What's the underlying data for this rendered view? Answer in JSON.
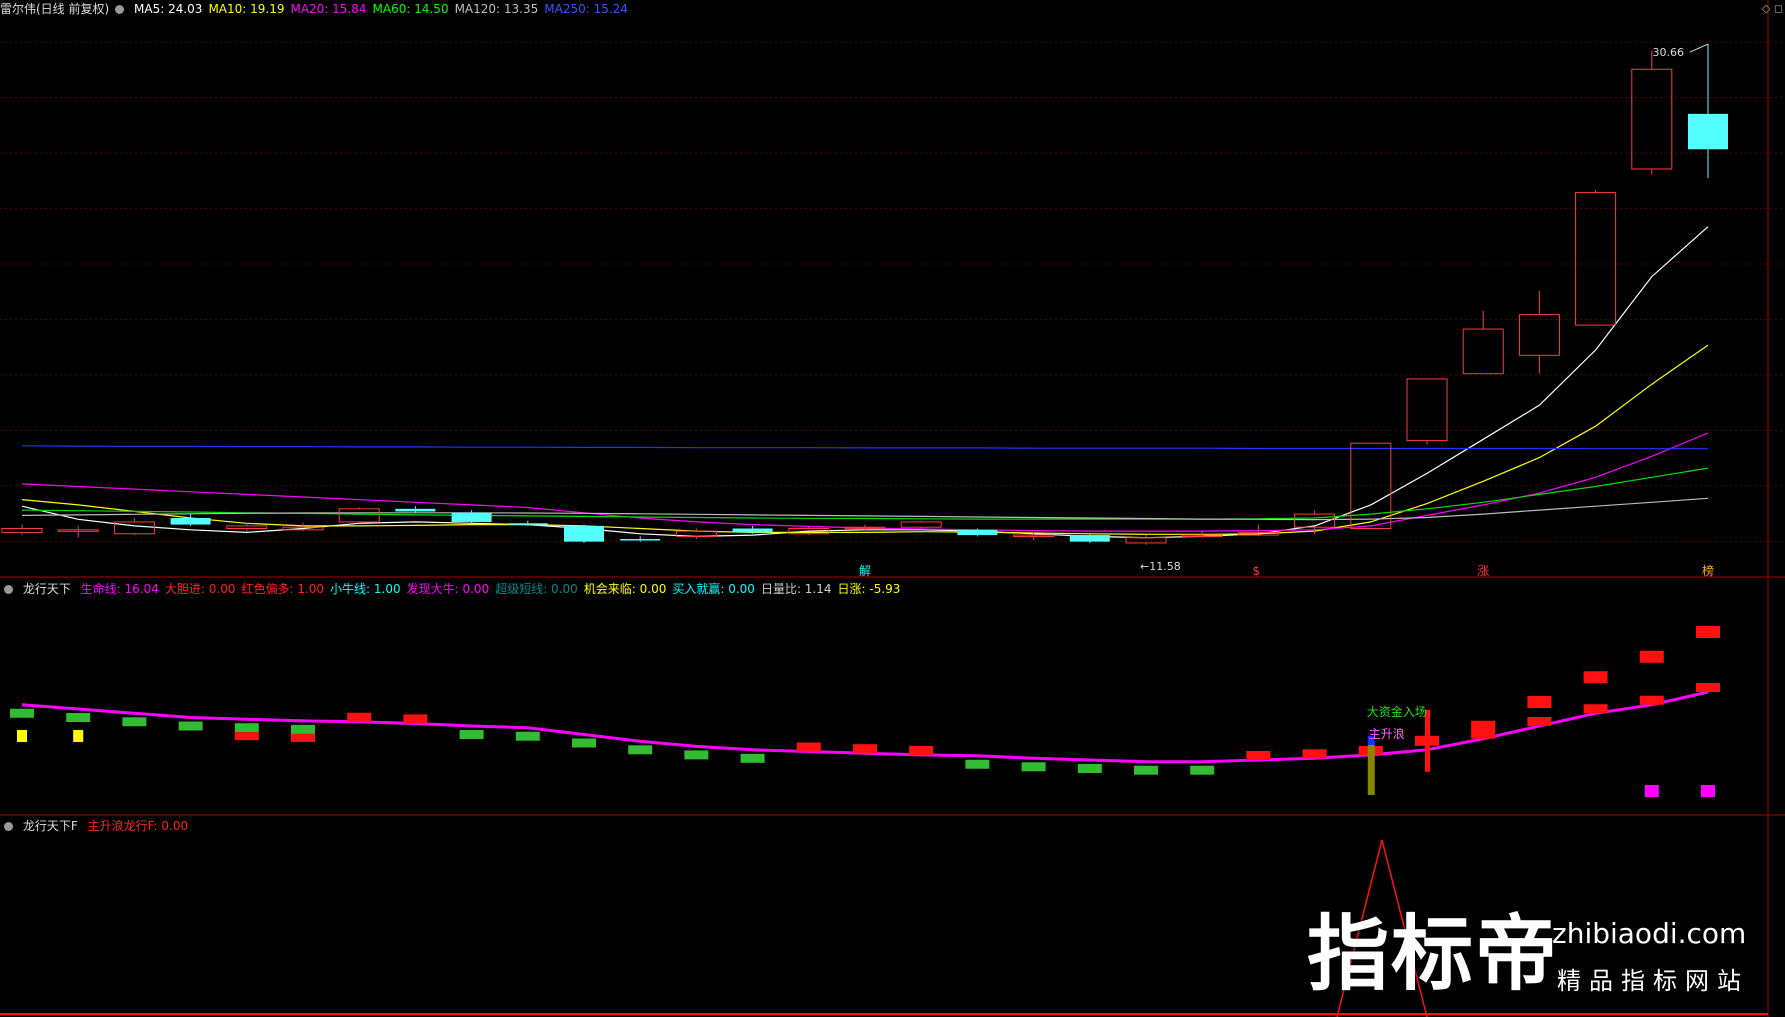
{
  "panel1": {
    "title": "雷尔伟(日线 前复权)",
    "ma": [
      {
        "label": "MA5: 24.03",
        "color": "#ffffff"
      },
      {
        "label": "MA10: 19.19",
        "color": "#ffff00"
      },
      {
        "label": "MA20: 15.84",
        "color": "#ff00ff"
      },
      {
        "label": "MA60: 14.50",
        "color": "#00ff00"
      },
      {
        "label": "MA120: 13.35",
        "color": "#c0c0c0"
      },
      {
        "label": "MA250: 15.24",
        "color": "#3355ff"
      }
    ],
    "high_label": "30.66",
    "low_label": "11.58",
    "markers": [
      {
        "text": "解",
        "color": "#00ffff",
        "idx": 15
      },
      {
        "text": "$",
        "color": "#ff3333",
        "idx": 22
      },
      {
        "text": "涨",
        "color": "#ff3333",
        "idx": 26
      },
      {
        "text": "榜",
        "color": "#ffaa00",
        "idx": 30
      }
    ]
  },
  "panel2": {
    "title": "龙行天下",
    "items": [
      {
        "label": "生命线: 16.04",
        "color": "#ff00ff"
      },
      {
        "label": "大胆进: 0.00",
        "color": "#ff2020"
      },
      {
        "label": "红色偏多: 1.00",
        "color": "#ff2020"
      },
      {
        "label": "小牛线: 1.00",
        "color": "#00ffff"
      },
      {
        "label": "发现大牛: 0.00",
        "color": "#ff00ff"
      },
      {
        "label": "超级短线: 0.00",
        "color": "#008888"
      },
      {
        "label": "机会来临: 0.00",
        "color": "#ffff00"
      },
      {
        "label": "买入就赢: 0.00",
        "color": "#00ffff"
      },
      {
        "label": "日量比: 1.14",
        "color": "#cccccc"
      },
      {
        "label": "日涨: -5.93",
        "color": "#ffff00"
      }
    ],
    "annotation1": "大资金入场",
    "annotation2": "主升浪"
  },
  "panel3": {
    "title": "龙行天下F",
    "item": {
      "label": "主升浪龙行F: 0.00",
      "color": "#ff2020"
    }
  },
  "logo": {
    "big": "指标帝",
    "site": "zhibiaodi.com",
    "tag": "精品指标网站"
  },
  "chart_data": {
    "type": "candlestick",
    "ylim": [
      11.0,
      31.5
    ],
    "candles": [
      {
        "o": 12.05,
        "c": 12.2,
        "h": 12.35,
        "l": 11.95
      },
      {
        "o": 12.1,
        "c": 12.15,
        "h": 12.3,
        "l": 11.85
      },
      {
        "o": 12.0,
        "c": 12.45,
        "h": 12.6,
        "l": 11.95
      },
      {
        "o": 12.6,
        "c": 12.35,
        "h": 12.75,
        "l": 12.3
      },
      {
        "o": 12.2,
        "c": 12.3,
        "h": 12.4,
        "l": 12.1
      },
      {
        "o": 12.15,
        "c": 12.25,
        "h": 12.4,
        "l": 12.1
      },
      {
        "o": 12.45,
        "c": 12.95,
        "h": 13.0,
        "l": 12.4
      },
      {
        "o": 12.95,
        "c": 12.85,
        "h": 13.05,
        "l": 12.8
      },
      {
        "o": 12.8,
        "c": 12.45,
        "h": 12.9,
        "l": 12.4
      },
      {
        "o": 12.4,
        "c": 12.38,
        "h": 12.5,
        "l": 12.3
      },
      {
        "o": 12.3,
        "c": 11.7,
        "h": 12.35,
        "l": 11.65
      },
      {
        "o": 11.8,
        "c": 11.78,
        "h": 11.9,
        "l": 11.7
      },
      {
        "o": 11.9,
        "c": 12.1,
        "h": 12.2,
        "l": 11.8
      },
      {
        "o": 12.2,
        "c": 12.05,
        "h": 12.3,
        "l": 12.0
      },
      {
        "o": 12.0,
        "c": 12.2,
        "h": 12.3,
        "l": 11.95
      },
      {
        "o": 12.2,
        "c": 12.25,
        "h": 12.35,
        "l": 12.1
      },
      {
        "o": 12.25,
        "c": 12.45,
        "h": 12.5,
        "l": 12.2
      },
      {
        "o": 12.15,
        "c": 11.95,
        "h": 12.2,
        "l": 11.9
      },
      {
        "o": 11.9,
        "c": 11.95,
        "h": 12.05,
        "l": 11.75
      },
      {
        "o": 11.95,
        "c": 11.7,
        "h": 12.0,
        "l": 11.65
      },
      {
        "o": 11.65,
        "c": 11.85,
        "h": 11.95,
        "l": 11.58
      },
      {
        "o": 11.9,
        "c": 11.95,
        "h": 12.1,
        "l": 11.85
      },
      {
        "o": 11.95,
        "c": 12.05,
        "h": 12.35,
        "l": 11.9
      },
      {
        "o": 12.25,
        "c": 12.75,
        "h": 12.9,
        "l": 12.0
      },
      {
        "o": 12.2,
        "c": 15.45,
        "h": 15.45,
        "l": 12.2
      },
      {
        "o": 15.55,
        "c": 17.9,
        "h": 17.9,
        "l": 15.4
      },
      {
        "o": 18.1,
        "c": 19.8,
        "h": 20.5,
        "l": 18.1
      },
      {
        "o": 18.8,
        "c": 20.35,
        "h": 21.25,
        "l": 18.1
      },
      {
        "o": 19.95,
        "c": 25.0,
        "h": 25.1,
        "l": 19.95
      },
      {
        "o": 25.9,
        "c": 29.7,
        "h": 30.4,
        "l": 25.7
      },
      {
        "o": 28.0,
        "c": 26.65,
        "h": 30.66,
        "l": 25.55
      }
    ],
    "ma_lines": {
      "MA5": [
        13.05,
        12.55,
        12.3,
        12.15,
        12.05,
        12.2,
        12.4,
        12.45,
        12.4,
        12.35,
        12.2,
        12.0,
        11.9,
        11.95,
        12.1,
        12.15,
        12.15,
        12.1,
        12.0,
        11.9,
        11.85,
        11.9,
        12.0,
        12.3,
        13.1,
        14.3,
        15.6,
        16.9,
        19.0,
        21.8,
        23.7
      ],
      "MA10": [
        13.3,
        13.1,
        12.85,
        12.6,
        12.4,
        12.3,
        12.3,
        12.32,
        12.35,
        12.35,
        12.3,
        12.2,
        12.1,
        12.05,
        12.05,
        12.05,
        12.08,
        12.06,
        12.03,
        12.0,
        11.98,
        11.98,
        12.0,
        12.1,
        12.45,
        13.15,
        14.0,
        14.9,
        16.1,
        17.7,
        19.19
      ],
      "MA20": [
        13.9,
        13.8,
        13.7,
        13.6,
        13.5,
        13.4,
        13.3,
        13.2,
        13.1,
        13.0,
        12.8,
        12.6,
        12.45,
        12.35,
        12.28,
        12.22,
        12.18,
        12.15,
        12.12,
        12.1,
        12.1,
        12.1,
        12.12,
        12.15,
        12.3,
        12.7,
        13.1,
        13.55,
        14.15,
        14.95,
        15.84
      ],
      "MA60": [
        12.9,
        12.88,
        12.85,
        12.83,
        12.8,
        12.78,
        12.75,
        12.72,
        12.7,
        12.68,
        12.66,
        12.64,
        12.62,
        12.6,
        12.59,
        12.58,
        12.57,
        12.56,
        12.56,
        12.56,
        12.56,
        12.56,
        12.57,
        12.6,
        12.75,
        12.95,
        13.2,
        13.5,
        13.8,
        14.15,
        14.5
      ],
      "MA120": [
        12.7,
        12.72,
        12.74,
        12.76,
        12.78,
        12.79,
        12.8,
        12.8,
        12.8,
        12.79,
        12.78,
        12.76,
        12.74,
        12.72,
        12.7,
        12.68,
        12.66,
        12.64,
        12.62,
        12.6,
        12.58,
        12.56,
        12.55,
        12.54,
        12.56,
        12.62,
        12.75,
        12.9,
        13.05,
        13.2,
        13.35
      ],
      "MA250": [
        15.35,
        15.34,
        15.33,
        15.33,
        15.32,
        15.32,
        15.31,
        15.31,
        15.3,
        15.3,
        15.29,
        15.29,
        15.28,
        15.28,
        15.28,
        15.27,
        15.27,
        15.27,
        15.26,
        15.26,
        15.26,
        15.26,
        15.25,
        15.25,
        15.25,
        15.25,
        15.25,
        15.25,
        15.24,
        15.24,
        15.24
      ]
    },
    "lifeline": [
      16.05,
      16.0,
      15.95,
      15.9,
      15.88,
      15.86,
      15.85,
      15.83,
      15.8,
      15.78,
      15.7,
      15.62,
      15.56,
      15.52,
      15.5,
      15.48,
      15.46,
      15.45,
      15.42,
      15.4,
      15.38,
      15.38,
      15.4,
      15.42,
      15.46,
      15.52,
      15.65,
      15.8,
      15.95,
      16.05,
      16.2
    ],
    "signal_blocks": [
      "g",
      "g",
      "g",
      "g",
      "gr",
      "gr",
      "r",
      "r",
      "g",
      "g",
      "g",
      "g",
      "g",
      "g",
      "r",
      "r",
      "r",
      "g",
      "g",
      "g",
      "g",
      "g",
      "r",
      "r",
      "r",
      "x",
      "r",
      "r",
      "r",
      "r",
      "r"
    ],
    "yellow_points": [
      0,
      1
    ],
    "magenta_points": [
      29,
      30
    ],
    "peak_f": {
      "idx": 25,
      "value": 1.0
    }
  }
}
